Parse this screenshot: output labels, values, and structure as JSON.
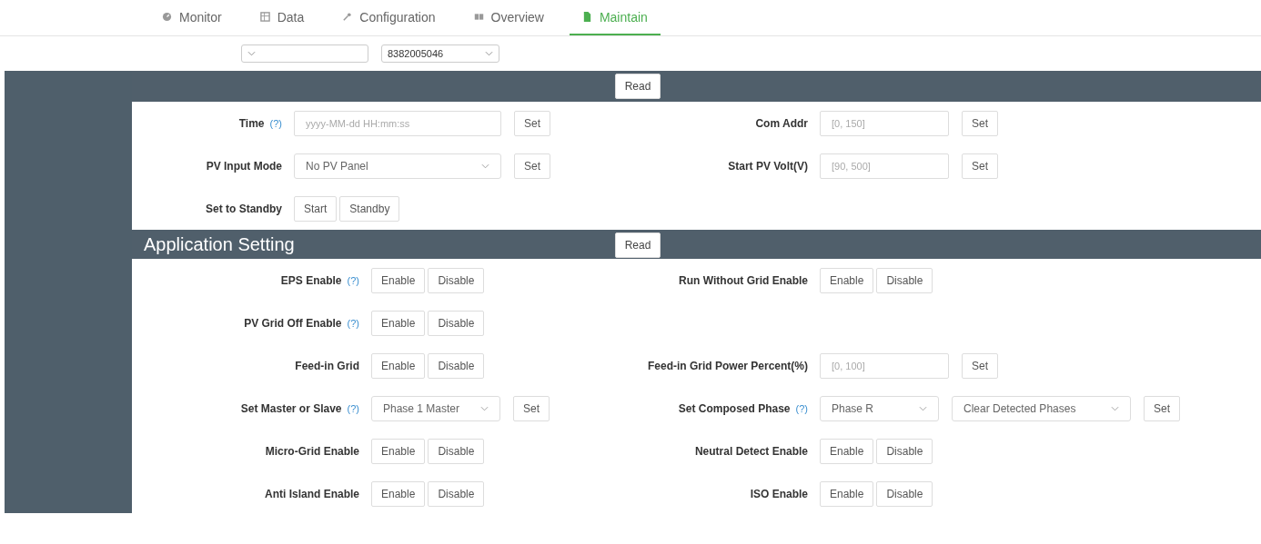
{
  "tabs": [
    {
      "label": "Monitor",
      "selected": false
    },
    {
      "label": "Data",
      "selected": false
    },
    {
      "label": "Configuration",
      "selected": false
    },
    {
      "label": "Overview",
      "selected": false
    },
    {
      "label": "Maintain",
      "selected": true
    }
  ],
  "device_select": {
    "value": "8382005046"
  },
  "sections": [
    {
      "read_button": "Read",
      "rows": [
        {
          "left": {
            "label": "Time",
            "help": "(?)",
            "controls": [
              {
                "kind": "input",
                "placeholder": "yyyy-MM-dd HH:mm:ss"
              },
              {
                "kind": "button",
                "label": "Set"
              }
            ]
          },
          "right": {
            "label": "Com Addr",
            "controls": [
              {
                "kind": "input",
                "placeholder": "[0, 150]"
              },
              {
                "kind": "button",
                "label": "Set"
              }
            ]
          }
        },
        {
          "left": {
            "label": "PV Input Mode",
            "controls": [
              {
                "kind": "select",
                "value": "No PV Panel"
              },
              {
                "kind": "button",
                "label": "Set"
              }
            ]
          },
          "right": {
            "label": "Start PV Volt(V)",
            "controls": [
              {
                "kind": "input",
                "placeholder": "[90, 500]"
              },
              {
                "kind": "button",
                "label": "Set"
              }
            ]
          }
        },
        {
          "left": {
            "label": "Set to Standby",
            "controls": [
              {
                "kind": "button",
                "label": "Start"
              },
              {
                "kind": "button",
                "label": "Standby"
              }
            ]
          }
        }
      ]
    },
    {
      "title": "Application Setting",
      "read_button": "Read",
      "rows": [
        {
          "left": {
            "label": "EPS Enable",
            "help": "(?)",
            "controls": [
              {
                "kind": "button",
                "label": "Enable"
              },
              {
                "kind": "button",
                "label": "Disable"
              }
            ]
          },
          "right": {
            "label": "Run Without Grid Enable",
            "controls": [
              {
                "kind": "button",
                "label": "Enable"
              },
              {
                "kind": "button",
                "label": "Disable"
              }
            ]
          }
        },
        {
          "left": {
            "label": "PV Grid Off Enable",
            "help": "(?)",
            "controls": [
              {
                "kind": "button",
                "label": "Enable"
              },
              {
                "kind": "button",
                "label": "Disable"
              }
            ]
          }
        },
        {
          "left": {
            "label": "Feed-in Grid",
            "controls": [
              {
                "kind": "button",
                "label": "Enable"
              },
              {
                "kind": "button",
                "label": "Disable"
              }
            ]
          },
          "right": {
            "label": "Feed-in Grid Power Percent(%)",
            "controls": [
              {
                "kind": "input",
                "placeholder": "[0, 100]"
              },
              {
                "kind": "button",
                "label": "Set"
              }
            ]
          }
        },
        {
          "left": {
            "label": "Set Master or Slave",
            "help": "(?)",
            "controls": [
              {
                "kind": "select",
                "value": "Phase 1 Master"
              },
              {
                "kind": "button",
                "label": "Set"
              }
            ]
          },
          "right": {
            "label": "Set Composed Phase",
            "help": "(?)",
            "controls": [
              {
                "kind": "select",
                "value": "Phase R"
              },
              {
                "kind": "select",
                "value": "Clear Detected Phases"
              },
              {
                "kind": "button",
                "label": "Set"
              }
            ]
          }
        },
        {
          "left": {
            "label": "Micro-Grid Enable",
            "controls": [
              {
                "kind": "button",
                "label": "Enable"
              },
              {
                "kind": "button",
                "label": "Disable"
              }
            ]
          },
          "right": {
            "label": "Neutral Detect Enable",
            "controls": [
              {
                "kind": "button",
                "label": "Enable"
              },
              {
                "kind": "button",
                "label": "Disable"
              }
            ]
          }
        },
        {
          "left": {
            "label": "Anti Island Enable",
            "controls": [
              {
                "kind": "button",
                "label": "Enable"
              },
              {
                "kind": "button",
                "label": "Disable"
              }
            ]
          },
          "right": {
            "label": "ISO Enable",
            "controls": [
              {
                "kind": "button",
                "label": "Enable"
              },
              {
                "kind": "button",
                "label": "Disable"
              }
            ]
          }
        }
      ]
    }
  ]
}
